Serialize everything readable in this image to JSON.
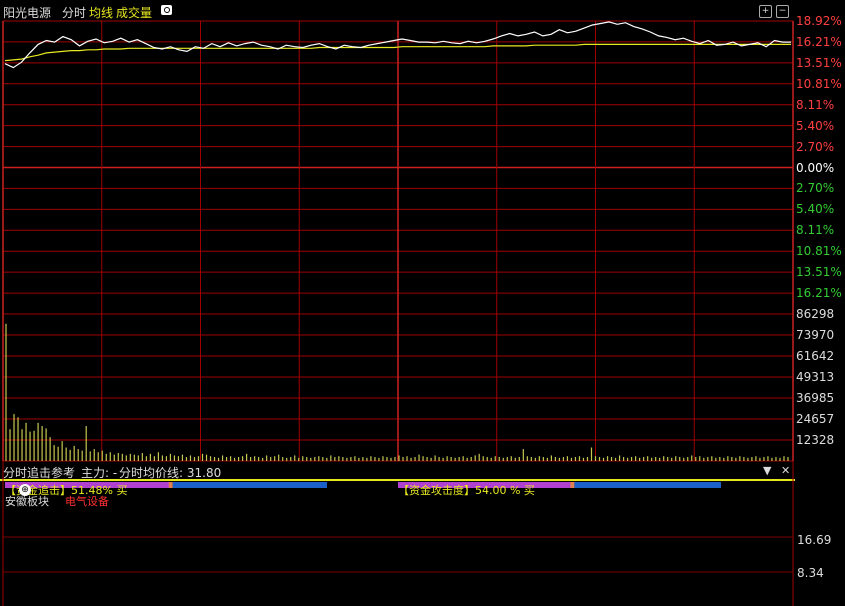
{
  "header": {
    "stock_name": "阳光电源",
    "tab_intraday": "分时",
    "tab_avg_line": "均线",
    "tab_volume": "成交量"
  },
  "price_axis": {
    "up_labels": [
      "18.92%",
      "16.21%",
      "13.51%",
      "10.81%",
      "8.11%",
      "5.40%",
      "2.70%"
    ],
    "zero_label": "0.00%",
    "down_labels": [
      "2.70%",
      "5.40%",
      "8.11%",
      "10.81%",
      "13.51%",
      "16.21%"
    ]
  },
  "volume_axis": {
    "labels": [
      "86298",
      "73970",
      "61642",
      "49313",
      "36985",
      "24657",
      "12328"
    ]
  },
  "chart_data": {
    "type": "line",
    "series": [
      {
        "values": [
          13.4,
          12.9,
          13.6,
          14.8,
          15.9,
          16.4,
          16.2,
          16.9,
          16.5,
          15.7,
          16.3,
          16.6,
          16.1,
          16.3,
          16.7,
          16.2,
          16.5,
          16.0,
          15.5,
          15.3,
          15.6,
          15.2,
          15.0,
          15.6,
          15.4,
          16.0,
          15.6,
          16.1,
          15.7,
          16.0,
          16.2,
          15.8,
          15.6,
          15.3,
          15.8,
          15.6,
          15.5,
          15.8,
          16.0,
          15.6,
          15.3,
          15.8,
          15.6,
          15.5,
          15.8,
          16.0,
          16.2,
          16.4,
          16.6,
          16.4,
          16.2,
          16.2,
          16.1,
          16.3,
          16.1,
          16.0,
          16.3,
          16.1,
          16.3,
          16.6,
          17.0,
          17.3,
          17.0,
          17.2,
          17.5,
          17.0,
          17.2,
          17.8,
          17.4,
          17.6,
          18.0,
          18.4,
          18.6,
          18.8,
          18.5,
          18.7,
          18.2,
          17.9,
          17.5,
          17.0,
          16.8,
          16.5,
          16.7,
          16.3,
          16.0,
          16.4,
          15.8,
          15.9,
          16.2,
          15.7,
          15.9,
          16.1,
          15.6,
          16.4,
          16.2,
          16.2
        ]
      },
      {
        "values": [
          13.8,
          13.9,
          14.0,
          14.3,
          14.5,
          14.8,
          14.9,
          15.0,
          15.1,
          15.1,
          15.2,
          15.2,
          15.3,
          15.3,
          15.3,
          15.4,
          15.4,
          15.4,
          15.4,
          15.4,
          15.4,
          15.4,
          15.4,
          15.4,
          15.4,
          15.4,
          15.4,
          15.4,
          15.4,
          15.4,
          15.4,
          15.4,
          15.4,
          15.4,
          15.4,
          15.4,
          15.4,
          15.4,
          15.5,
          15.5,
          15.5,
          15.5,
          15.5,
          15.5,
          15.5,
          15.5,
          15.5,
          15.5,
          15.6,
          15.6,
          15.6,
          15.6,
          15.6,
          15.6,
          15.6,
          15.6,
          15.6,
          15.6,
          15.6,
          15.7,
          15.7,
          15.7,
          15.7,
          15.7,
          15.8,
          15.8,
          15.8,
          15.8,
          15.8,
          15.8,
          15.9,
          15.9,
          15.9,
          15.9,
          15.9,
          15.9,
          15.9,
          15.9,
          15.9,
          15.9,
          15.9,
          15.9,
          15.9,
          15.9,
          15.9,
          15.9,
          15.9,
          15.9,
          15.9,
          15.9,
          15.9,
          15.9,
          15.9,
          15.9,
          15.9,
          15.9
        ]
      }
    ],
    "ylim": [
      -18.92,
      18.92
    ],
    "volume": {
      "ylim": [
        0,
        92462
      ],
      "values": [
        86298,
        20000,
        29500,
        27500,
        20000,
        24000,
        18500,
        19000,
        24000,
        22000,
        20500,
        15000,
        10000,
        9000,
        12500,
        8500,
        7000,
        9500,
        7500,
        6500,
        22000,
        6000,
        7500,
        5500,
        6500,
        4500,
        5500,
        4000,
        5000,
        4500,
        3500,
        4500,
        4000,
        3500,
        5000,
        3000,
        4500,
        3000,
        5500,
        3500,
        3000,
        4500,
        3500,
        3000,
        4000,
        2500,
        3500,
        2500,
        3000,
        4500,
        4000,
        3000,
        2500,
        2000,
        3500,
        2500,
        3000,
        2000,
        2500,
        3000,
        4500,
        2500,
        3000,
        2500,
        2000,
        3500,
        2500,
        3000,
        4000,
        2500,
        2000,
        2500,
        3500,
        2000,
        3000,
        2500,
        2000,
        2500,
        3000,
        2500,
        2000,
        3500,
        2500,
        3000,
        2500,
        2000,
        2500,
        3000,
        2000,
        2500,
        2000,
        3000,
        2500,
        2000,
        3000,
        2500,
        2000,
        2500,
        3500,
        2500,
        3000,
        2000,
        2500,
        4000,
        3000,
        2500,
        2000,
        3500,
        2500,
        2000,
        3000,
        2500,
        2000,
        2500,
        3000,
        2000,
        2500,
        3500,
        4500,
        3000,
        2500,
        2000,
        3000,
        2500,
        2000,
        2500,
        3000,
        2000,
        2500,
        7500,
        3000,
        2500,
        2000,
        3000,
        2500,
        2000,
        3500,
        2500,
        2000,
        2500,
        3000,
        2000,
        2500,
        3000,
        2000,
        2500,
        8500,
        3000,
        2500,
        2000,
        3000,
        2500,
        2000,
        3500,
        2500,
        2000,
        2500,
        3000,
        2000,
        2500,
        3000,
        2000,
        2500,
        2000,
        3000,
        2500,
        2000,
        3000,
        2500,
        2000,
        2500,
        3500,
        2500,
        3000,
        2000,
        2500,
        3000,
        2000,
        2500,
        2000,
        3000,
        2500,
        2000,
        3000,
        2500,
        2000,
        2500,
        3000,
        2000,
        2500,
        3000,
        2000,
        2500,
        2000,
        3000,
        2500
      ]
    }
  },
  "indicator_panel": {
    "title": "分时追击参考",
    "main_force_label": "主力: -",
    "avg_line_label": "分时均价线: 31.80",
    "left_meter_text": "【资金追击】51.48% 买",
    "right_meter_text": "【资金攻击度】54.00 % 买",
    "sector_label": "安徽板块",
    "industry_label": "电气设备",
    "axis_labels": [
      "16.69",
      "8.34"
    ],
    "left_meter_fill": 0.5148,
    "right_meter_fill": 0.54
  },
  "colors": {
    "grid": "#a00000",
    "axis_up": "#ff4040",
    "axis_down": "#33cc33",
    "price_line": "#ffffff",
    "avg_line": "#e8e820",
    "volume_bar": "#c8c850",
    "meter_purple": "#b040d0",
    "meter_blue": "#1a60c8"
  }
}
